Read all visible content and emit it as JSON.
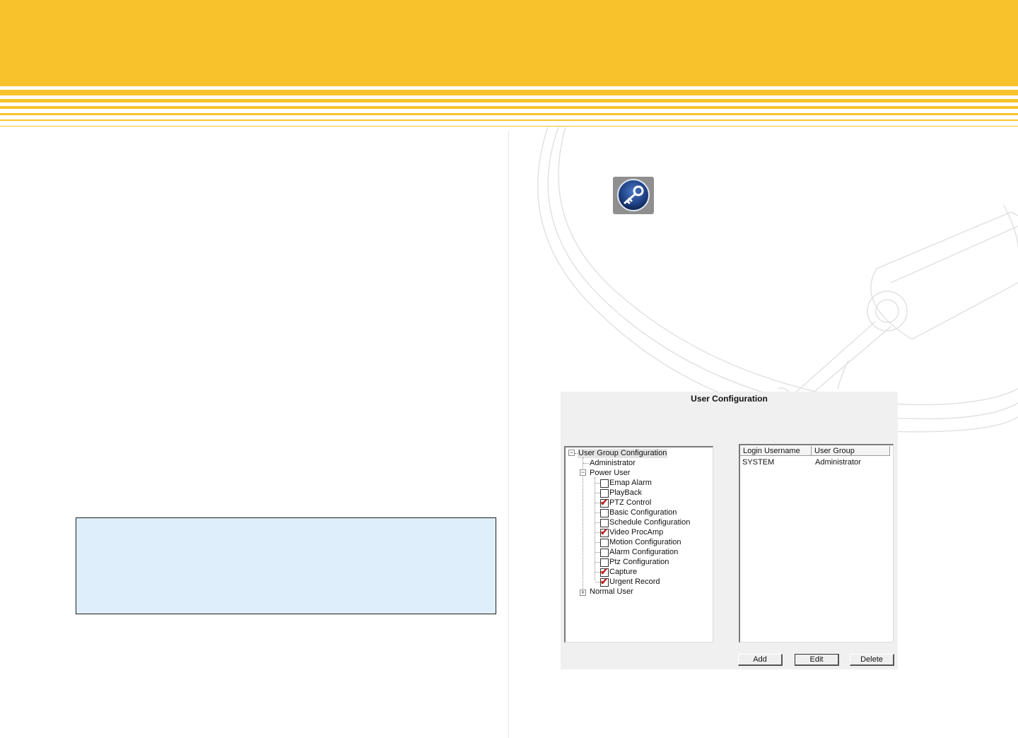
{
  "dialog": {
    "title": "User Configuration",
    "tree": {
      "root": "User Group Configuration",
      "groups": [
        "Administrator",
        "Power User",
        "Normal User"
      ],
      "permissions": [
        {
          "label": "Emap Alarm",
          "checked": false
        },
        {
          "label": "PlayBack",
          "checked": false
        },
        {
          "label": "PTZ Control",
          "checked": true
        },
        {
          "label": "Basic Configuration",
          "checked": false
        },
        {
          "label": "Schedule Configuration",
          "checked": false
        },
        {
          "label": "Video ProcAmp",
          "checked": true
        },
        {
          "label": "Motion Configuration",
          "checked": false
        },
        {
          "label": "Alarm Configuration",
          "checked": false
        },
        {
          "label": "Ptz Configuration",
          "checked": false
        },
        {
          "label": "Capture",
          "checked": true
        },
        {
          "label": "Urgent Record",
          "checked": true
        }
      ]
    },
    "list": {
      "columns": [
        "Login Username",
        "User Group"
      ],
      "rows": [
        [
          "SYSTEM",
          "Administrator"
        ]
      ]
    },
    "buttons": {
      "add": "Add",
      "edit": "Edit",
      "delete": "Delete"
    }
  },
  "colors": {
    "header_yellow": "#f8c22c",
    "note_box_bg": "#deeffb",
    "check_red": "#c21d1d"
  },
  "icons": {
    "key_icon": "key-icon"
  }
}
